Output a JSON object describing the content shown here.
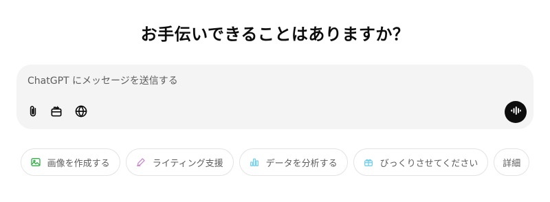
{
  "headline": "お手伝いできることはありますか？",
  "composer": {
    "placeholder": "ChatGPT にメッセージを送信する",
    "value": ""
  },
  "toolbar": {
    "attach_icon": "paperclip-icon",
    "tools_icon": "toolbox-icon",
    "web_icon": "globe-icon",
    "voice_icon": "voice-waveform-icon"
  },
  "suggestions": [
    {
      "label": "画像を作成する",
      "icon": "image-icon",
      "color": "#35ae47"
    },
    {
      "label": "ライティング支援",
      "icon": "pen-icon",
      "color": "#cb8bd0"
    },
    {
      "label": "データを分析する",
      "icon": "bar-chart-icon",
      "color": "#76d0eb"
    },
    {
      "label": "びっくりさせてください",
      "icon": "gift-icon",
      "color": "#76d0eb"
    },
    {
      "label": "詳細",
      "icon": "",
      "color": ""
    }
  ]
}
